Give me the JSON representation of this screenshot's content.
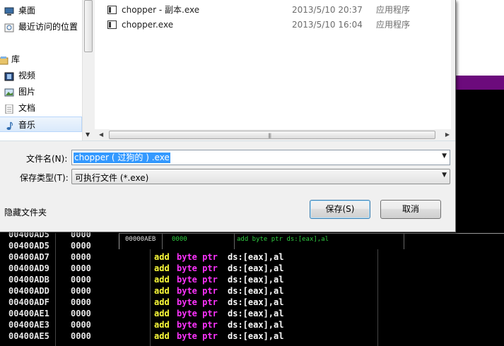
{
  "dialog": {
    "nav": {
      "items": [
        {
          "label": "桌面",
          "icon": "desktop-icon"
        },
        {
          "label": "最近访问的位置",
          "icon": "recent-places-icon"
        },
        {
          "label": "库",
          "icon": "library-icon"
        },
        {
          "label": "视频",
          "icon": "video-icon"
        },
        {
          "label": "图片",
          "icon": "picture-icon"
        },
        {
          "label": "文档",
          "icon": "document-icon"
        },
        {
          "label": "音乐",
          "icon": "music-icon"
        }
      ]
    },
    "files": [
      {
        "name": "chopper - 副本.exe",
        "date": "2013/5/10 20:37",
        "type": "应用程序"
      },
      {
        "name": "chopper.exe",
        "date": "2013/5/10 16:04",
        "type": "应用程序"
      }
    ],
    "filename_label": "文件名(N):",
    "filename_value": "chopper ( 过狗的 ) .exe",
    "filetype_label": "保存类型(T):",
    "filetype_value": "可执行文件 (*.exe)",
    "hide_folders_label": "隐藏文件夹",
    "save_label": "保存(S)",
    "cancel_label": "取消"
  },
  "debugger": {
    "rows": [
      {
        "addr": "00400AD5",
        "hex": "0000",
        "mn": "",
        "op": "",
        "mem": ""
      },
      {
        "addr": "00400AD7",
        "hex": "0000",
        "mn": "add",
        "op": "byte ptr",
        "mem": "ds:[eax],al"
      },
      {
        "addr": "00400AD9",
        "hex": "0000",
        "mn": "add",
        "op": "byte ptr",
        "mem": "ds:[eax],al"
      },
      {
        "addr": "00400ADB",
        "hex": "0000",
        "mn": "add",
        "op": "byte ptr",
        "mem": "ds:[eax],al"
      },
      {
        "addr": "00400ADD",
        "hex": "0000",
        "mn": "add",
        "op": "byte ptr",
        "mem": "ds:[eax],al"
      },
      {
        "addr": "00400ADF",
        "hex": "0000",
        "mn": "add",
        "op": "byte ptr",
        "mem": "ds:[eax],al"
      },
      {
        "addr": "00400AE1",
        "hex": "0000",
        "mn": "add",
        "op": "byte ptr",
        "mem": "ds:[eax],al"
      },
      {
        "addr": "00400AE3",
        "hex": "0000",
        "mn": "add",
        "op": "byte ptr",
        "mem": "ds:[eax],al"
      },
      {
        "addr": "00400AE5",
        "hex": "0000",
        "mn": "add",
        "op": "byte ptr",
        "mem": "ds:[eax],al"
      }
    ],
    "mini": {
      "addr": "00000AEB",
      "hex": "0000",
      "instr": "add byte ptr ds:[eax],al"
    }
  },
  "colors": {
    "accent_purple": "#6c0b7c",
    "selection": "#3399ff",
    "mnemonic": "#ffff3a",
    "operand": "#ff33ff"
  }
}
